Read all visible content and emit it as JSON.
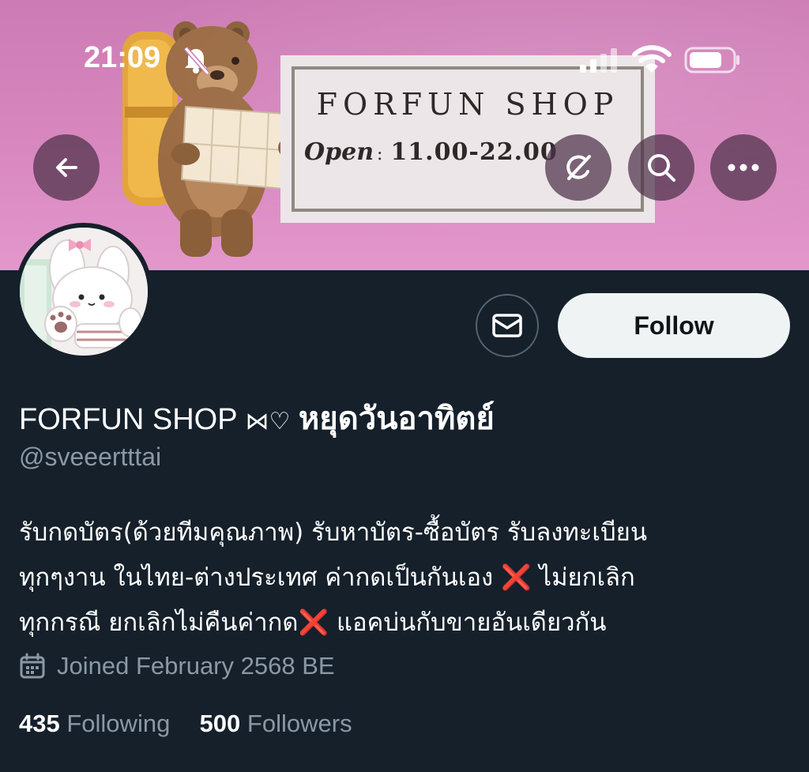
{
  "status_bar": {
    "time": "21:09",
    "silent_icon": "bell-slash-icon",
    "signal_icon": "cellular-signal-icon",
    "wifi_icon": "wifi-icon",
    "battery_icon": "battery-icon"
  },
  "banner": {
    "sign_title": "FORFUN SHOP",
    "sign_open": "Open",
    "sign_colon": ":",
    "sign_hours": "11.00-22.00"
  },
  "header": {
    "back_icon": "arrow-left-icon",
    "grok_icon": "grok-icon",
    "search_icon": "search-icon",
    "more_icon": "more-horizontal-icon"
  },
  "profile": {
    "name_prefix": "FORFUN SHOP",
    "name_decor": "⋈♡",
    "name_thai": "หยุดวันอาทิตย์",
    "handle": "@sveeertttai",
    "bio_line1": "รับกดบัตร(ด้วยทีมคุณภาพ) รับหาบัตร-ซื้อบัตร รับลงทะเบียน",
    "bio_line2": "ทุกๆงาน ในไทย-ต่างประเทศ ค่ากดเป็นกันเอง ❌ ไม่ยกเลิก",
    "bio_line3": "ทุกกรณี ยกเลิกไม่คืนค่ากด❌ แอคบ่นกับขายอันเดียวกัน",
    "joined": "Joined February 2568 BE",
    "following_count": "435",
    "following_label": "Following",
    "followers_count": "500",
    "followers_label": "Followers"
  },
  "actions": {
    "message_icon": "envelope-icon",
    "follow_label": "Follow"
  },
  "colors": {
    "background": "#15202b",
    "banner_pink": "#d685bd",
    "muted_text": "#8b98a5",
    "follow_bg": "#eff3f4",
    "x_red": "#e0245e"
  }
}
